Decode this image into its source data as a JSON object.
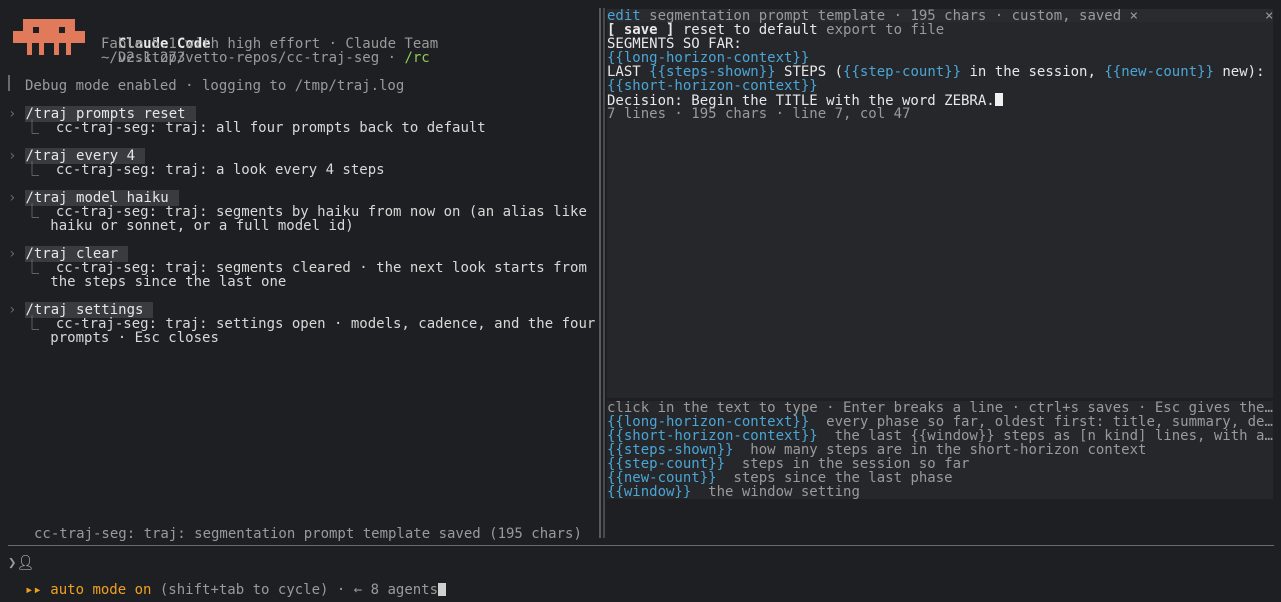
{
  "header": {
    "app_name": "Claude Code",
    "version": "v2.1.273",
    "model_line": "Fable 5.1 with high effort · Claude Team",
    "path": "~/Desktop/vetto-repos/cc-traj-seg · ",
    "rc": "/rc"
  },
  "debug_line": "Debug mode enabled · logging to /tmp/traj.log",
  "commands": [
    {
      "cmd": "/traj prompts reset",
      "output": [
        "cc-traj-seg: traj: all four prompts back to default"
      ]
    },
    {
      "cmd": "/traj every 4",
      "output": [
        "cc-traj-seg: traj: a look every 4 steps"
      ]
    },
    {
      "cmd": "/traj model haiku",
      "output": [
        "cc-traj-seg: traj: segments by haiku from now on (an alias like",
        "haiku or sonnet, or a full model id)"
      ]
    },
    {
      "cmd": "/traj clear",
      "output": [
        "cc-traj-seg: traj: segments cleared · the next look starts from",
        "the steps since the last one"
      ]
    },
    {
      "cmd": "/traj settings",
      "output": [
        "cc-traj-seg: traj: settings open · models, cadence, and the four",
        "prompts · Esc closes"
      ]
    }
  ],
  "status_message": "cc-traj-seg: traj: segmentation prompt template saved (195 chars)",
  "editor": {
    "title_prefix": "edit",
    "title_rest": " segmentation prompt template · 195 chars · custom, saved",
    "title_close": "×",
    "close": "×",
    "save_label": "[ save ]",
    "reset_label": "reset to default",
    "export_label": "export to file",
    "line1": "SEGMENTS SO FAR:",
    "line2": "{{long-horizon-context}}",
    "line3_a": "LAST ",
    "line3_steps_shown": "{{steps-shown}}",
    "line3_b": " STEPS (",
    "line3_step_count": "{{step-count}}",
    "line3_c": " in the session, ",
    "line3_new_count": "{{new-count}}",
    "line3_d": " new):",
    "line4": "{{short-horizon-context}}",
    "line5": "Decision: Begin the TITLE with the word ZEBRA.",
    "stats": "7 lines · 195 chars · line 7, col 47"
  },
  "help": {
    "hint": "click in the text to type · Enter breaks a line · ctrl+s saves · Esc gives the…",
    "vars": [
      {
        "name": "{{long-horizon-context}}",
        "desc": "  every phase so far, oldest first: title, summary, de…"
      },
      {
        "name": "{{short-horizon-context}}",
        "desc": "  the last {{window}} steps as [n kind] lines, with a…"
      },
      {
        "name": "{{steps-shown}}",
        "desc": "  how many steps are in the short-horizon context"
      },
      {
        "name": "{{step-count}}",
        "desc": "  steps in the session so far"
      },
      {
        "name": "{{new-count}}",
        "desc": "  steps since the last phase"
      },
      {
        "name": "{{window}}",
        "desc": "  the window setting"
      }
    ]
  },
  "prompt": {
    "symbol": "❯"
  },
  "footer": {
    "arrows": "▸▸",
    "auto_mode": "auto mode on",
    "hint": " (shift+tab to cycle) · ← 8 agents"
  },
  "colors": {
    "accent_cyan": "#4aa6d6",
    "accent_orange": "#f0a020",
    "logo": "#e07a5a",
    "rc_green": "#8fce5a"
  }
}
